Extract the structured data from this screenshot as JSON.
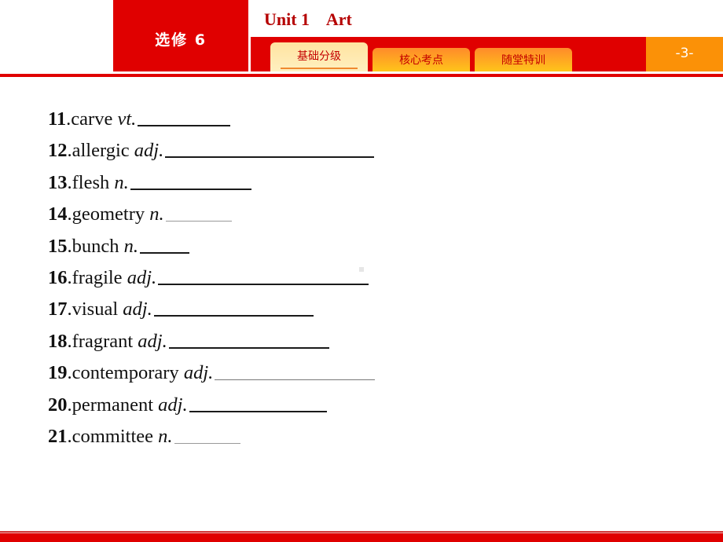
{
  "header": {
    "course": "选修 6",
    "unit_title": "Unit 1    Art",
    "tabs": [
      {
        "label": "基础分级",
        "active": true
      },
      {
        "label": "核心考点",
        "active": false
      },
      {
        "label": "随堂特训",
        "active": false
      }
    ],
    "page_number": "-3-"
  },
  "exercise": {
    "items": [
      {
        "num": "11",
        "word": "carve",
        "pos": "vt."
      },
      {
        "num": "12",
        "word": "allergic",
        "pos": "adj."
      },
      {
        "num": "13",
        "word": "flesh",
        "pos": "n."
      },
      {
        "num": "14",
        "word": "geometry",
        "pos": "n."
      },
      {
        "num": "15",
        "word": "bunch",
        "pos": "n."
      },
      {
        "num": "16",
        "word": "fragile",
        "pos": "adj."
      },
      {
        "num": "17",
        "word": "visual",
        "pos": "adj."
      },
      {
        "num": "18",
        "word": "fragrant",
        "pos": "adj."
      },
      {
        "num": "19",
        "word": "contemporary",
        "pos": "adj."
      },
      {
        "num": "20",
        "word": "permanent",
        "pos": "adj."
      },
      {
        "num": "21",
        "word": "committee",
        "pos": "n."
      }
    ]
  },
  "colors": {
    "brand_red": "#e00000",
    "title_red": "#b50000",
    "page_orange": "#fb9107",
    "active_tab": "#ffe3a0"
  }
}
